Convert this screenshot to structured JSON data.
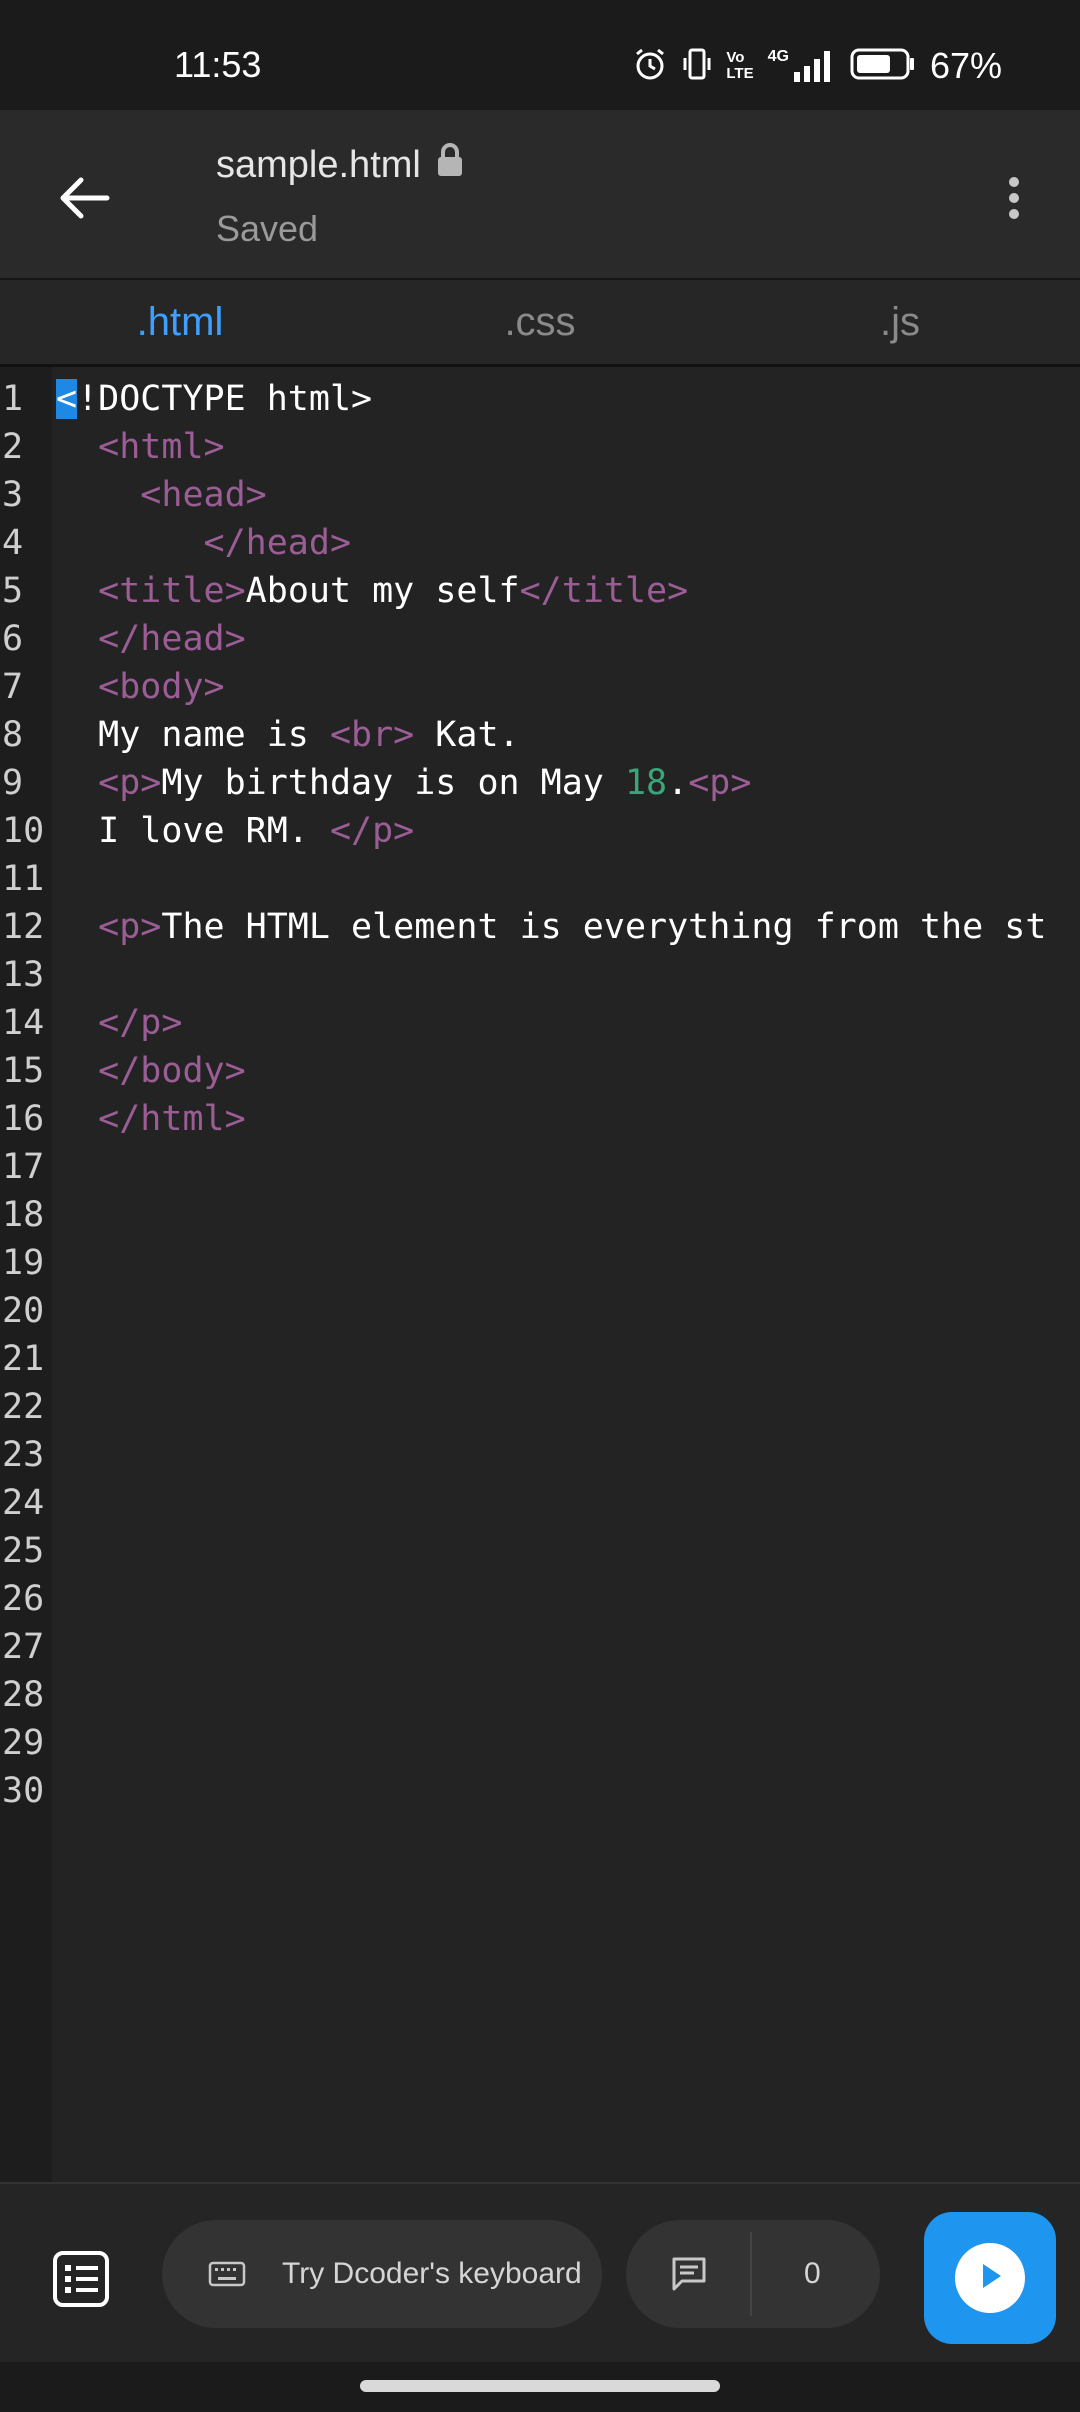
{
  "status_bar": {
    "time": "11:53",
    "battery_percent": "67%",
    "volte_label": "Vo\nLTE",
    "network_label": "4G",
    "icons": [
      "alarm-icon",
      "vibrate-icon",
      "volte-icon",
      "signal-icon",
      "battery-icon"
    ]
  },
  "app_bar": {
    "file_name": "sample.html",
    "save_status": "Saved",
    "icons": [
      "back-arrow-icon",
      "lock-icon",
      "more-vertical-icon"
    ]
  },
  "tabs": [
    {
      "label": ".html",
      "active": true
    },
    {
      "label": ".css",
      "active": false
    },
    {
      "label": ".js",
      "active": false
    }
  ],
  "editor": {
    "lines": [
      {
        "n": "1",
        "tokens": [
          {
            "t": "<",
            "c": "cursor"
          },
          {
            "t": "!DOCTYPE html>",
            "c": "txt"
          }
        ]
      },
      {
        "n": "2",
        "tokens": [
          {
            "t": "  ",
            "c": "txt"
          },
          {
            "t": "<html>",
            "c": "tag"
          }
        ]
      },
      {
        "n": "3",
        "tokens": [
          {
            "t": "    ",
            "c": "txt"
          },
          {
            "t": "<head>",
            "c": "tag"
          }
        ]
      },
      {
        "n": "4",
        "tokens": [
          {
            "t": "       ",
            "c": "txt"
          },
          {
            "t": "</head>",
            "c": "tag"
          }
        ]
      },
      {
        "n": "5",
        "tokens": [
          {
            "t": "  ",
            "c": "txt"
          },
          {
            "t": "<title>",
            "c": "tag"
          },
          {
            "t": "About my self",
            "c": "txt"
          },
          {
            "t": "</title>",
            "c": "tag"
          }
        ]
      },
      {
        "n": "6",
        "tokens": [
          {
            "t": "  ",
            "c": "txt"
          },
          {
            "t": "</head>",
            "c": "tag"
          }
        ]
      },
      {
        "n": "7",
        "tokens": [
          {
            "t": "  ",
            "c": "txt"
          },
          {
            "t": "<body>",
            "c": "tag"
          }
        ]
      },
      {
        "n": "8",
        "tokens": [
          {
            "t": "  My name is ",
            "c": "txt"
          },
          {
            "t": "<br>",
            "c": "tag"
          },
          {
            "t": " Kat.",
            "c": "txt"
          }
        ]
      },
      {
        "n": "9",
        "tokens": [
          {
            "t": "  ",
            "c": "txt"
          },
          {
            "t": "<p>",
            "c": "tag"
          },
          {
            "t": "My birthday is on May ",
            "c": "txt"
          },
          {
            "t": "18",
            "c": "num"
          },
          {
            "t": ".",
            "c": "txt"
          },
          {
            "t": "<p>",
            "c": "tag"
          }
        ]
      },
      {
        "n": "10",
        "tokens": [
          {
            "t": "  I love RM. ",
            "c": "txt"
          },
          {
            "t": "</p>",
            "c": "tag"
          }
        ]
      },
      {
        "n": "11",
        "tokens": []
      },
      {
        "n": "12",
        "tokens": [
          {
            "t": "  ",
            "c": "txt"
          },
          {
            "t": "<p>",
            "c": "tag"
          },
          {
            "t": "The HTML element is everything from the st",
            "c": "txt"
          }
        ]
      },
      {
        "n": "13",
        "tokens": []
      },
      {
        "n": "14",
        "tokens": [
          {
            "t": "  ",
            "c": "txt"
          },
          {
            "t": "</p>",
            "c": "tag"
          }
        ]
      },
      {
        "n": "15",
        "tokens": [
          {
            "t": "  ",
            "c": "txt"
          },
          {
            "t": "</body>",
            "c": "tag"
          }
        ]
      },
      {
        "n": "16",
        "tokens": [
          {
            "t": "  ",
            "c": "txt"
          },
          {
            "t": "</html>",
            "c": "tag"
          }
        ]
      },
      {
        "n": "17",
        "tokens": []
      },
      {
        "n": "18",
        "tokens": []
      },
      {
        "n": "19",
        "tokens": []
      },
      {
        "n": "20",
        "tokens": []
      },
      {
        "n": "21",
        "tokens": []
      },
      {
        "n": "22",
        "tokens": []
      },
      {
        "n": "23",
        "tokens": []
      },
      {
        "n": "24",
        "tokens": []
      },
      {
        "n": "25",
        "tokens": []
      },
      {
        "n": "26",
        "tokens": []
      },
      {
        "n": "27",
        "tokens": []
      },
      {
        "n": "28",
        "tokens": []
      },
      {
        "n": "29",
        "tokens": []
      },
      {
        "n": "30",
        "tokens": []
      }
    ]
  },
  "bottom_bar": {
    "keyboard_hint": "Try Dcoder's keyboard",
    "comment_count": "0",
    "icons": [
      "list-icon",
      "keyboard-icon",
      "comment-icon",
      "play-icon"
    ]
  },
  "colors": {
    "accent": "#3da0ff",
    "run_button": "#1e96f0",
    "tag": "#9b5d95",
    "number": "#3aa57a",
    "background": "#222222"
  }
}
